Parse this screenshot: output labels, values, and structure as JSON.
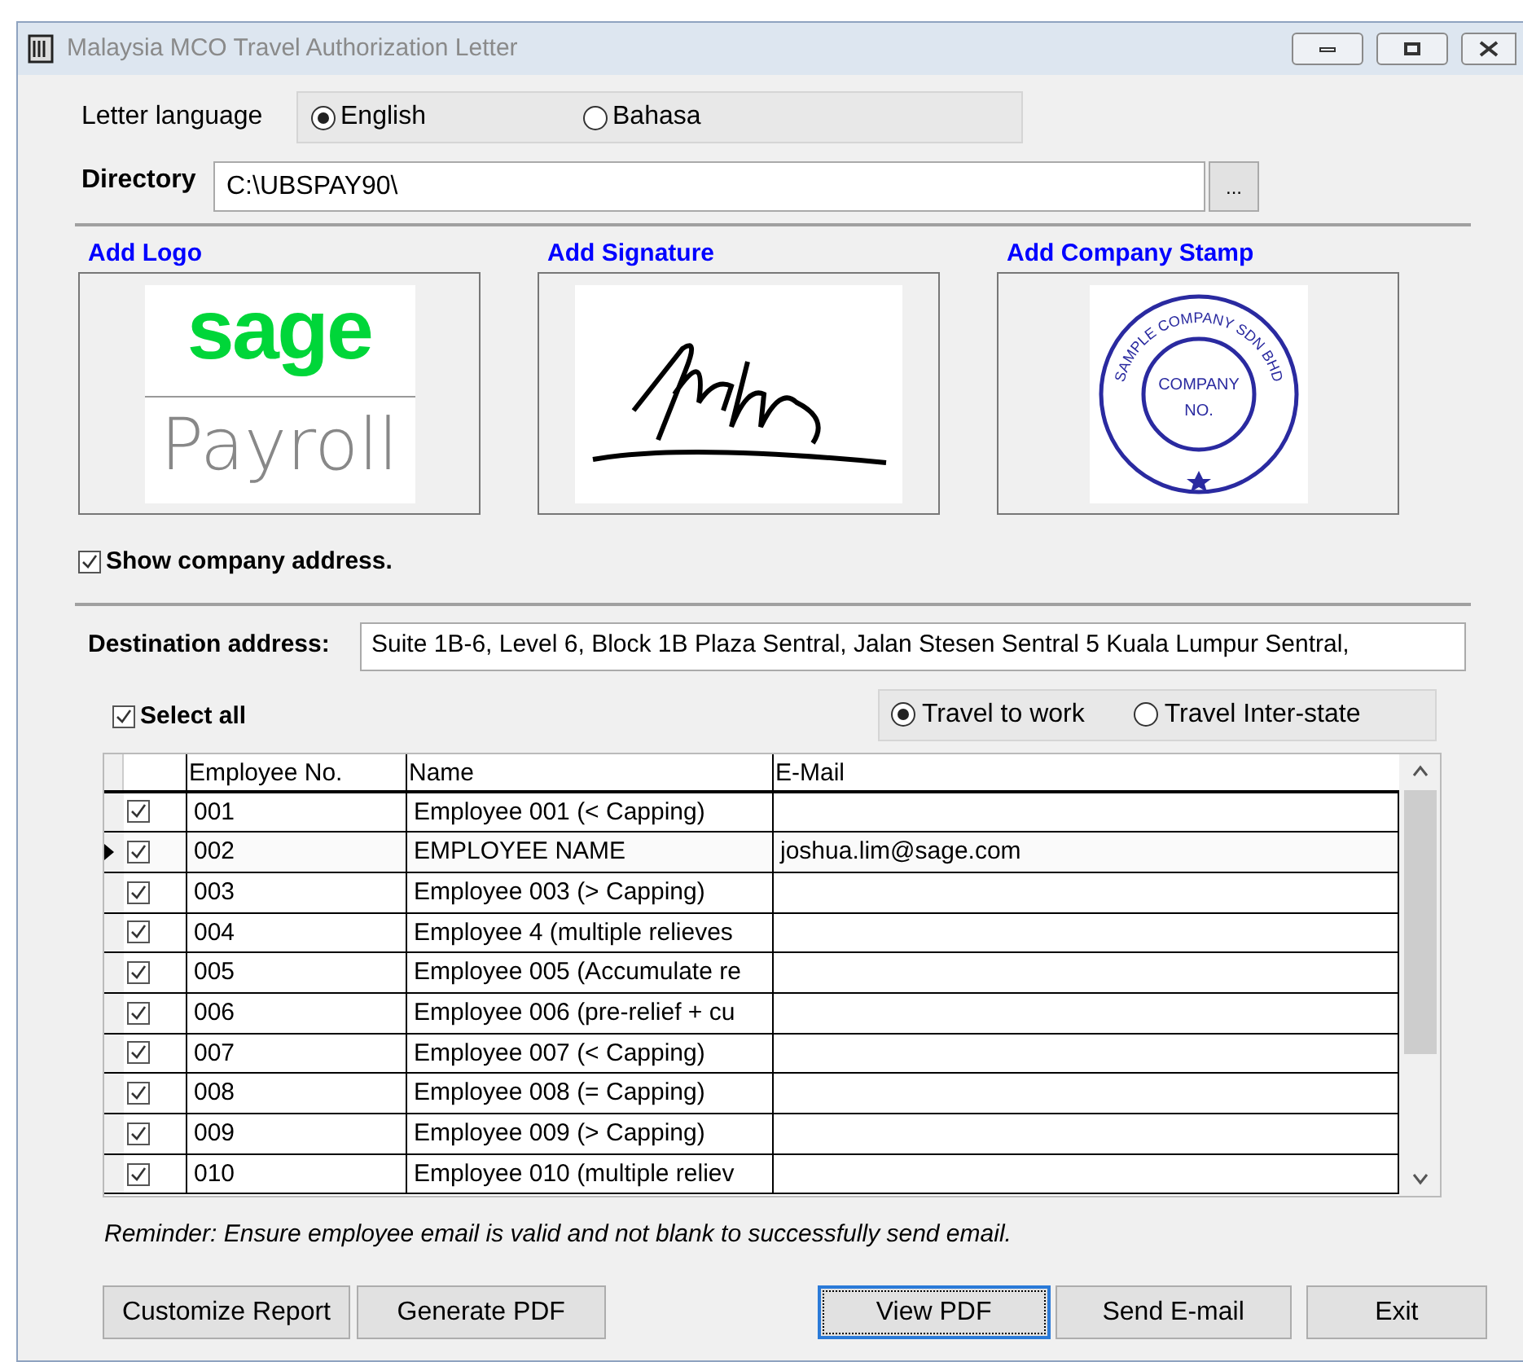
{
  "window": {
    "title": "Malaysia MCO Travel Authorization Letter"
  },
  "letter_language": {
    "label": "Letter language",
    "options": [
      {
        "label": "English",
        "selected": true
      },
      {
        "label": "Bahasa",
        "selected": false
      }
    ]
  },
  "directory": {
    "label": "Directory",
    "value": "C:\\UBSPAY90\\",
    "browse": "..."
  },
  "images": [
    {
      "kind": "logo",
      "label": "Add Logo",
      "texts": [
        "sage",
        "Payroll"
      ]
    },
    {
      "kind": "signature",
      "label": "Add Signature"
    },
    {
      "kind": "stamp",
      "label": "Add Company Stamp",
      "texts": [
        "SAMPLE COMPANY SDN BHD",
        "COMPANY",
        "NO."
      ]
    }
  ],
  "show_company_address": {
    "label": "Show company address.",
    "checked": true
  },
  "destination": {
    "label": "Destination address:",
    "value": "Suite 1B-6, Level 6, Block 1B Plaza Sentral, Jalan Stesen Sentral 5 Kuala Lumpur Sentral,"
  },
  "select_all": {
    "label": "Select all",
    "checked": true
  },
  "travel_type": [
    {
      "label": "Travel to work",
      "selected": true
    },
    {
      "label": "Travel Inter-state",
      "selected": false
    }
  ],
  "table": {
    "columns": [
      "Employee No.",
      "Name",
      "E-Mail"
    ],
    "rows": [
      {
        "checked": true,
        "selected": false,
        "cells": [
          "001",
          "Employee 001 (< Capping)",
          ""
        ]
      },
      {
        "checked": true,
        "selected": true,
        "cells": [
          "002",
          "EMPLOYEE NAME",
          "joshua.lim@sage.com"
        ]
      },
      {
        "checked": true,
        "selected": false,
        "cells": [
          "003",
          "Employee 003 (> Capping)",
          ""
        ]
      },
      {
        "checked": true,
        "selected": false,
        "cells": [
          "004",
          "Employee 4 (multiple relieves",
          ""
        ]
      },
      {
        "checked": true,
        "selected": false,
        "cells": [
          "005",
          "Employee 005 (Accumulate re",
          ""
        ]
      },
      {
        "checked": true,
        "selected": false,
        "cells": [
          "006",
          "Employee 006 (pre-relief + cu",
          ""
        ]
      },
      {
        "checked": true,
        "selected": false,
        "cells": [
          "007",
          "Employee 007 (< Capping)",
          ""
        ]
      },
      {
        "checked": true,
        "selected": false,
        "cells": [
          "008",
          "Employee 008 (= Capping)",
          ""
        ]
      },
      {
        "checked": true,
        "selected": false,
        "cells": [
          "009",
          "Employee 009 (> Capping)",
          ""
        ]
      },
      {
        "checked": true,
        "selected": false,
        "cells": [
          "010",
          "Employee 010 (multiple reliev",
          ""
        ]
      }
    ]
  },
  "reminder": "Reminder: Ensure employee email is valid and not blank to successfully send email.",
  "buttons": [
    {
      "label": "Customize Report",
      "focused": false
    },
    {
      "label": "Generate PDF",
      "focused": false
    },
    {
      "label": "View PDF",
      "focused": true
    },
    {
      "label": "Send E-mail",
      "focused": false
    },
    {
      "label": "Exit",
      "focused": false
    }
  ]
}
